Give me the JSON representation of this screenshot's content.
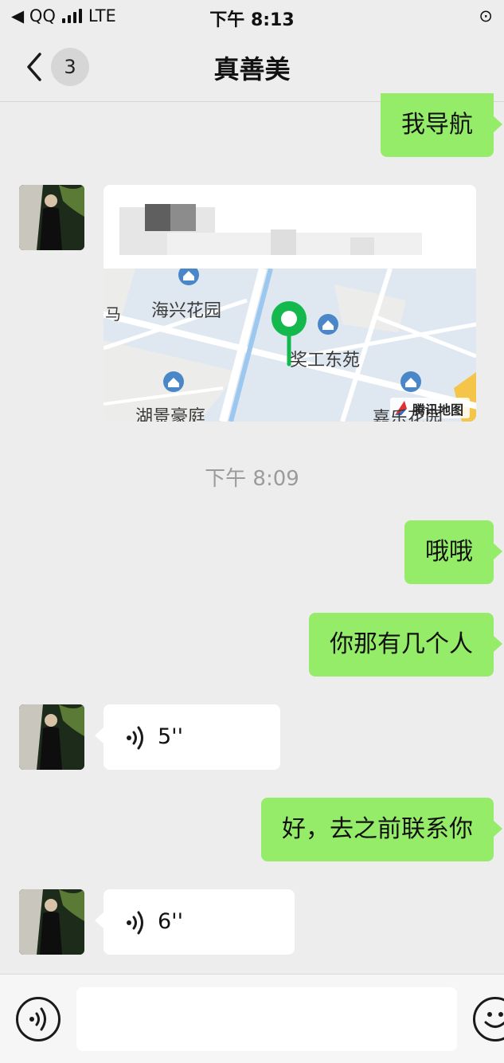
{
  "status_bar": {
    "back_app": "◀ QQ",
    "network": "LTE",
    "time": "下午 8:13",
    "rotation_lock": "⊙"
  },
  "nav": {
    "badge_count": "3",
    "title": "真善美"
  },
  "messages": {
    "m1": "我导航",
    "location": {
      "name": "",
      "address": "",
      "map_labels": {
        "haixing": "海兴花园",
        "jianggong": "奖工东苑",
        "hujing": "湖景豪庭",
        "jiale": "嘉乐花园",
        "ma": "马",
        "logo": "腾讯地图"
      }
    },
    "timestamp": "下午 8:09",
    "m2": "哦哦",
    "m3": "你那有几个人",
    "voice1": "5''",
    "m4": "好，去之前联系你",
    "voice2": "6''"
  },
  "colors": {
    "outgoing_bubble": "#95ec69",
    "incoming_bubble": "#ffffff",
    "background": "#ededed",
    "pin": "#13b94c"
  }
}
